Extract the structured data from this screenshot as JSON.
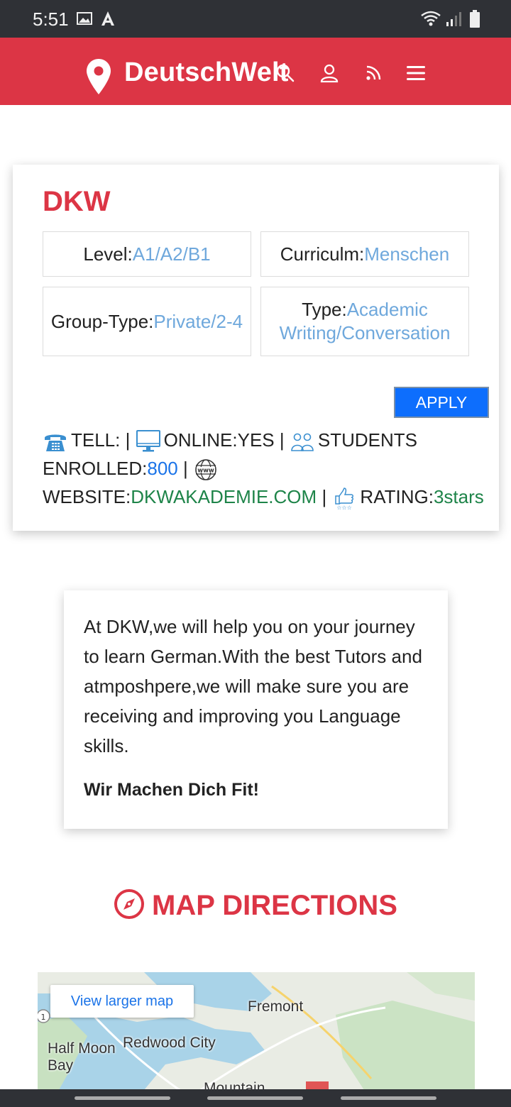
{
  "status_bar": {
    "time": "5:51"
  },
  "navbar": {
    "brand": "DeutschWelt",
    "icons": [
      "map-pin-icon",
      "search-icon",
      "user-icon",
      "rss-icon",
      "menu-icon"
    ]
  },
  "school": {
    "name": "DKW",
    "level_label": "Level:",
    "level_value": "A1/A2/B1",
    "curriculum_label": "Curriculm:",
    "curriculum_value": "Menschen",
    "group_label": "Group-Type:",
    "group_value": "Private/2-4",
    "type_label": "Type:",
    "type_value": "Academic Writing/Conversation",
    "apply_label": "APPLY",
    "tell_label": "TELL: |",
    "online_label": "ONLINE:YES |",
    "students_label": "STUDENTS ENROLLED:",
    "students_value": "800",
    "website_label": "WEBSITE:",
    "website_value": "DKWAKADEMIE.COM",
    "rating_label": "RATING:",
    "rating_value": "3stars"
  },
  "about": {
    "text": "At DKW,we will help you on your journey to learn German.With the best Tutors and atmposhpere,we will make sure you are receiving and improving you Language skills.",
    "motto": "Wir Machen Dich Fit!"
  },
  "map_section": {
    "heading": "MAP DIRECTIONS",
    "view_larger": "View larger map",
    "labels": {
      "fremont": "Fremont",
      "redwood": "Redwood City",
      "half_moon": "Half Moon Bay",
      "mountain": "Mountain"
    }
  },
  "colors": {
    "brand_red": "#dc3545",
    "link_blue": "#6fa8dc",
    "apply_blue": "#0d6efd",
    "green": "#1e8449"
  }
}
